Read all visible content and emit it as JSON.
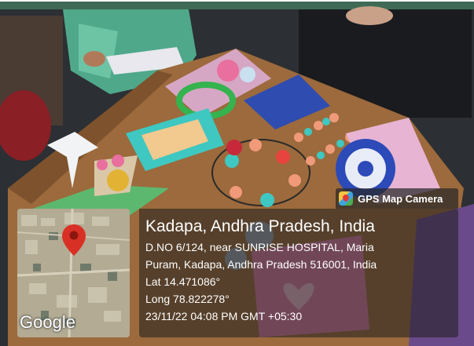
{
  "gps_badge": {
    "label": "GPS Map Camera",
    "icon": "gps-map-camera-icon"
  },
  "map": {
    "logo": "Google",
    "pin_icon": "map-pin-icon",
    "pin_color": "#d93025"
  },
  "location": {
    "title": "Kadapa, Andhra Pradesh, India",
    "address_line_1": "D.NO 6/124, near SUNRISE HOSPITAL, Maria",
    "address_line_2": "Puram, Kadapa, Andhra Pradesh 516001, India",
    "latitude": "Lat 14.471086°",
    "longitude": "Long 78.822278°",
    "timestamp": "23/11/22 04:08 PM GMT +05:30"
  }
}
